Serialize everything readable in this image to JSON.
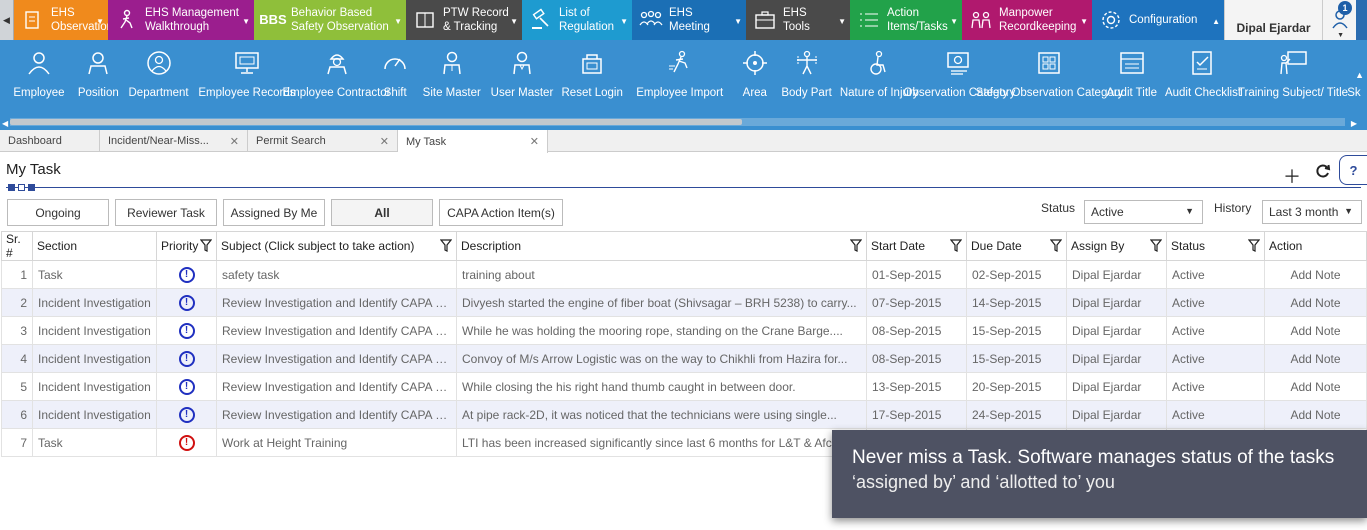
{
  "modules": [
    {
      "line1": "EHS",
      "line2": "Observation",
      "color": "#f08a1c",
      "icon": "observation-icon",
      "width": 94
    },
    {
      "line1": "EHS Management",
      "line2": "Walkthrough",
      "color": "#9b1e8e",
      "icon": "walkthrough-icon",
      "width": 146
    },
    {
      "line1": "Behavior Based",
      "line2": "Safety Observation",
      "color": "#8fbf3a",
      "icon": "bbs-icon",
      "width": 152
    },
    {
      "line1": "PTW Record",
      "line2": "& Tracking",
      "color": "#4a4a4a",
      "icon": "ptw-icon",
      "width": 116
    },
    {
      "line1": "List of",
      "line2": "Regulation",
      "color": "#1e9bd0",
      "icon": "gavel-icon",
      "width": 110
    },
    {
      "line1": "EHS",
      "line2": "Meeting",
      "color": "#1b6fb5",
      "icon": "meeting-icon",
      "width": 114
    },
    {
      "line1": "EHS",
      "line2": "Tools",
      "color": "#4a4a4a",
      "icon": "toolbox-icon",
      "width": 104
    },
    {
      "line1": "Action",
      "line2": "Items/Tasks",
      "color": "#22a24a",
      "icon": "checklist-icon",
      "width": 112
    },
    {
      "line1": "Manpower",
      "line2": "Recordkeeping",
      "color": "#b0196e",
      "icon": "manpower-icon",
      "width": 130
    },
    {
      "line1": "Configuration",
      "line2": "",
      "color": "#1e73be",
      "icon": "gear-icon",
      "width": 132
    }
  ],
  "user": {
    "name": "Dipal Ejardar",
    "badge": "1"
  },
  "masters": [
    {
      "label": "Employee",
      "icon": "user-icon"
    },
    {
      "label": "Position",
      "icon": "position-icon"
    },
    {
      "label": "Department",
      "icon": "department-icon"
    },
    {
      "label": "Employee Records",
      "icon": "monitor-icon"
    },
    {
      "label": "Employee Contractor",
      "icon": "contractor-icon"
    },
    {
      "label": "Shift",
      "icon": "gauge-icon"
    },
    {
      "label": "Site Master",
      "icon": "site-master-icon"
    },
    {
      "label": "User Master",
      "icon": "user-master-icon"
    },
    {
      "label": "Reset Login",
      "icon": "reset-login-icon"
    },
    {
      "label": "Employee Import",
      "icon": "import-icon"
    },
    {
      "label": "Area",
      "icon": "target-icon"
    },
    {
      "label": "Body Part",
      "icon": "body-part-icon"
    },
    {
      "label": "Nature of Injury",
      "icon": "injury-icon"
    },
    {
      "label": "Observation Category",
      "icon": "observation-category-icon"
    },
    {
      "label": "Safety Observation Category",
      "icon": "safety-category-icon"
    },
    {
      "label": "Audit Title",
      "icon": "audit-title-icon"
    },
    {
      "label": "Audit Checklist",
      "icon": "audit-checklist-icon"
    },
    {
      "label": "Training Subject/ Title",
      "icon": "training-icon"
    },
    {
      "label": "Sk",
      "icon": ""
    }
  ],
  "tabs": [
    {
      "label": "Dashboard",
      "closable": false
    },
    {
      "label": "Incident/Near-Miss...",
      "closable": true
    },
    {
      "label": "Permit Search",
      "closable": true
    },
    {
      "label": "My Task",
      "closable": true,
      "active": true
    }
  ],
  "page": {
    "title": "My Task"
  },
  "filters": [
    "Ongoing",
    "Reviewer Task",
    "Assigned By Me",
    "All",
    "CAPA Action Item(s)"
  ],
  "status": {
    "label": "Status",
    "value": "Active"
  },
  "history": {
    "label": "History",
    "value": "Last 3 month"
  },
  "columns": [
    "Sr. #",
    "Section",
    "Priority",
    "Subject  (Click subject to take action)",
    "Description",
    "Start Date",
    "Due Date",
    "Assign By",
    "Status",
    "Action"
  ],
  "rows": [
    {
      "sr": "1",
      "section": "Task",
      "priority": "normal",
      "subject": "safety task",
      "description": "training about",
      "start": "01-Sep-2015",
      "due": "02-Sep-2015",
      "assign": "Dipal Ejardar",
      "status": "Active",
      "action": "Add Note"
    },
    {
      "sr": "2",
      "section": "Incident Investigation",
      "priority": "normal",
      "subject": "Review Investigation and Identify CAPA of Incident",
      "description": "Divyesh started the engine of fiber boat (Shivsagar – BRH 5238) to carry...",
      "start": "07-Sep-2015",
      "due": "14-Sep-2015",
      "assign": "Dipal Ejardar",
      "status": "Active",
      "action": "Add Note"
    },
    {
      "sr": "3",
      "section": "Incident Investigation",
      "priority": "normal",
      "subject": "Review Investigation and Identify CAPA of Incident",
      "description": "While he was holding the mooring rope, standing on the Crane Barge....",
      "start": "08-Sep-2015",
      "due": "15-Sep-2015",
      "assign": "Dipal Ejardar",
      "status": "Active",
      "action": "Add Note"
    },
    {
      "sr": "4",
      "section": "Incident Investigation",
      "priority": "normal",
      "subject": "Review Investigation and Identify CAPA of Incident",
      "description": "Convoy of M/s Arrow Logistic was on the way to Chikhli from Hazira for...",
      "start": "08-Sep-2015",
      "due": "15-Sep-2015",
      "assign": "Dipal Ejardar",
      "status": "Active",
      "action": "Add Note"
    },
    {
      "sr": "5",
      "section": "Incident Investigation",
      "priority": "normal",
      "subject": "Review Investigation and Identify CAPA of Incident",
      "description": "While closing the his right hand thumb caught in between door.",
      "start": "13-Sep-2015",
      "due": "20-Sep-2015",
      "assign": "Dipal Ejardar",
      "status": "Active",
      "action": "Add Note"
    },
    {
      "sr": "6",
      "section": "Incident Investigation",
      "priority": "normal",
      "subject": "Review Investigation and Identify CAPA of Incident",
      "description": "At pipe rack-2D, it was noticed that the technicians were using single...",
      "start": "17-Sep-2015",
      "due": "24-Sep-2015",
      "assign": "Dipal Ejardar",
      "status": "Active",
      "action": "Add Note"
    },
    {
      "sr": "7",
      "section": "Task",
      "priority": "high",
      "subject": "Work at Height Training",
      "description": "LTI has been increased significantly since last 6 months for L&T & Afcons",
      "start": "",
      "due": "",
      "assign": "",
      "status": "",
      "action": ""
    }
  ],
  "callout": {
    "line1": "Never miss a Task. Software manages status of the tasks",
    "line2": "‘assigned by’ and ‘allotted to’ you"
  }
}
